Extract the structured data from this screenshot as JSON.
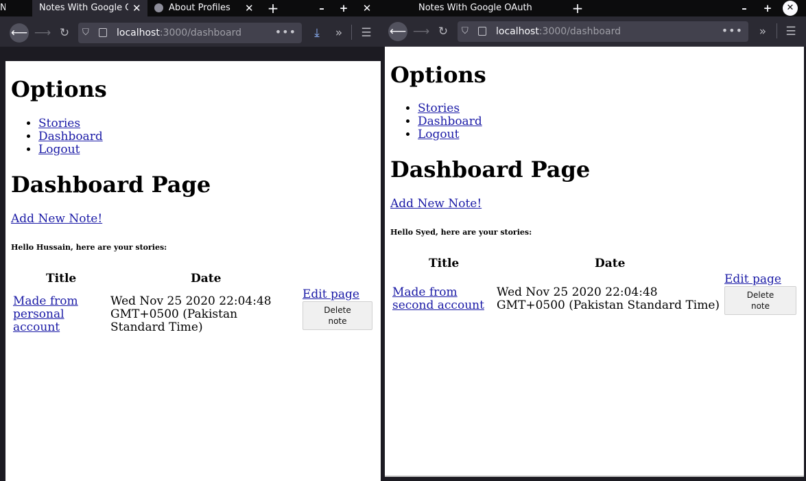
{
  "left_window": {
    "tabs": [
      {
        "title": "Notes With Google O",
        "close": "✕"
      },
      {
        "title": "About Profiles",
        "close": "✕"
      }
    ],
    "partial_tab": "N",
    "new_tab": "+",
    "window_controls": {
      "minimize": "–",
      "maximize": "+",
      "close": "✕"
    },
    "url": {
      "host": "localhost",
      "path": ":3000/dashboard"
    },
    "page": {
      "options_heading": "Options",
      "nav_links": [
        "Stories",
        "Dashboard",
        "Logout"
      ],
      "dashboard_heading": "Dashboard Page",
      "add_note": "Add New Note!",
      "greeting": "Hello Hussain, here are your stories:",
      "columns": [
        "Title",
        "Date"
      ],
      "rows": [
        {
          "title": "Made from personal account",
          "date": "Wed Nov 25 2020 22:04:48 GMT+0500 (Pakistan Standard Time)",
          "edit": "Edit page",
          "delete": "Delete note"
        }
      ]
    }
  },
  "right_window": {
    "tabs": [
      {
        "title": "Notes With Google OAuth"
      }
    ],
    "new_tab": "+",
    "window_controls": {
      "minimize": "–",
      "maximize": "+",
      "close": "✕"
    },
    "url": {
      "host": "localhost",
      "path": ":3000/dashboard"
    },
    "page": {
      "options_heading": "Options",
      "nav_links": [
        "Stories",
        "Dashboard",
        "Logout"
      ],
      "dashboard_heading": "Dashboard Page",
      "add_note": "Add New Note!",
      "greeting": "Hello Syed, here are your stories:",
      "columns": [
        "Title",
        "Date"
      ],
      "rows": [
        {
          "title": "Made from second account",
          "date": "Wed Nov 25 2020 22:04:48 GMT+0500 (Pakistan Standard Time)",
          "edit": "Edit page",
          "delete": "Delete note"
        }
      ]
    }
  },
  "icons": [
    "back-arrow-icon",
    "forward-arrow-icon",
    "reload-icon",
    "shield-icon",
    "page-icon",
    "more-dots-icon",
    "download-icon",
    "overflow-chevrons-icon",
    "hamburger-menu-icon",
    "firefox-icon"
  ],
  "colors": {
    "chrome_dark": "#0c0c0d",
    "toolbar": "#2b2a33",
    "urlbar": "#42414d",
    "link": "#1a1aa6"
  }
}
